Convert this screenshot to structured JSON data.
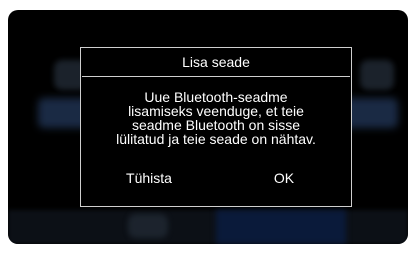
{
  "dialog": {
    "title": "Lisa seade",
    "message_lines": [
      "Uue Bluetooth-seadme",
      "lisamiseks veenduge, et teie",
      "seadme Bluetooth on sisse",
      "lülitatud ja teie seade on nähtav."
    ],
    "cancel_label": "Tühista",
    "ok_label": "OK"
  },
  "colors": {
    "screen_background": "#000000",
    "dialog_border": "#cfcfcf",
    "text": "#ffffff"
  }
}
